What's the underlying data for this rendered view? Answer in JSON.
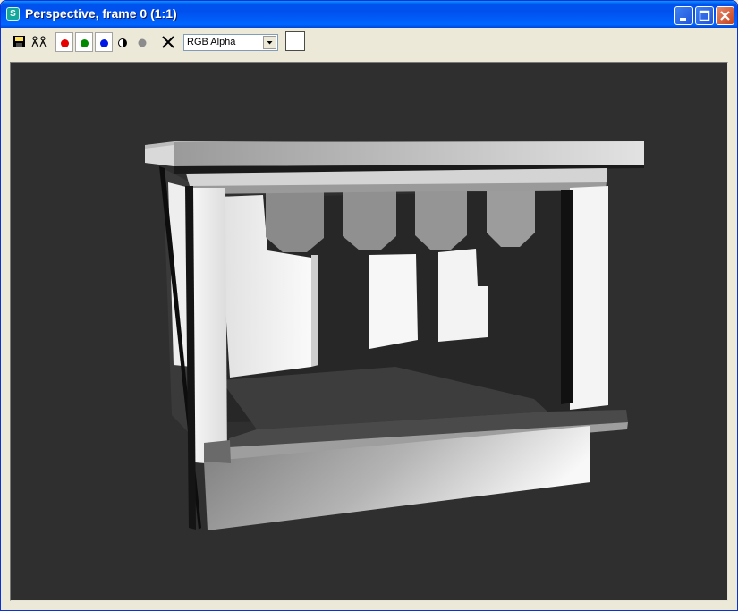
{
  "window": {
    "title": "Perspective, frame 0 (1:1)",
    "app_icon": "3ds-max-icon"
  },
  "window_buttons": [
    "minimize-icon",
    "maximize-icon",
    "close-icon"
  ],
  "toolbar": {
    "save_icon": "save-icon",
    "clone_icon": "clone-render-icon",
    "channels": [
      {
        "name": "red",
        "color": "#e60000"
      },
      {
        "name": "green",
        "color": "#008a00"
      },
      {
        "name": "blue",
        "color": "#0018e6"
      }
    ],
    "mono_icon": "mono-icon",
    "alpha_icon": "alpha-dot-icon",
    "clear_icon": "clear-x-icon",
    "channel_select": {
      "value": "RGB Alpha"
    },
    "swatch_color": "#ffffff"
  },
  "viewport": {
    "background": "#2f2f2f",
    "content": "rendered-market-stall"
  }
}
